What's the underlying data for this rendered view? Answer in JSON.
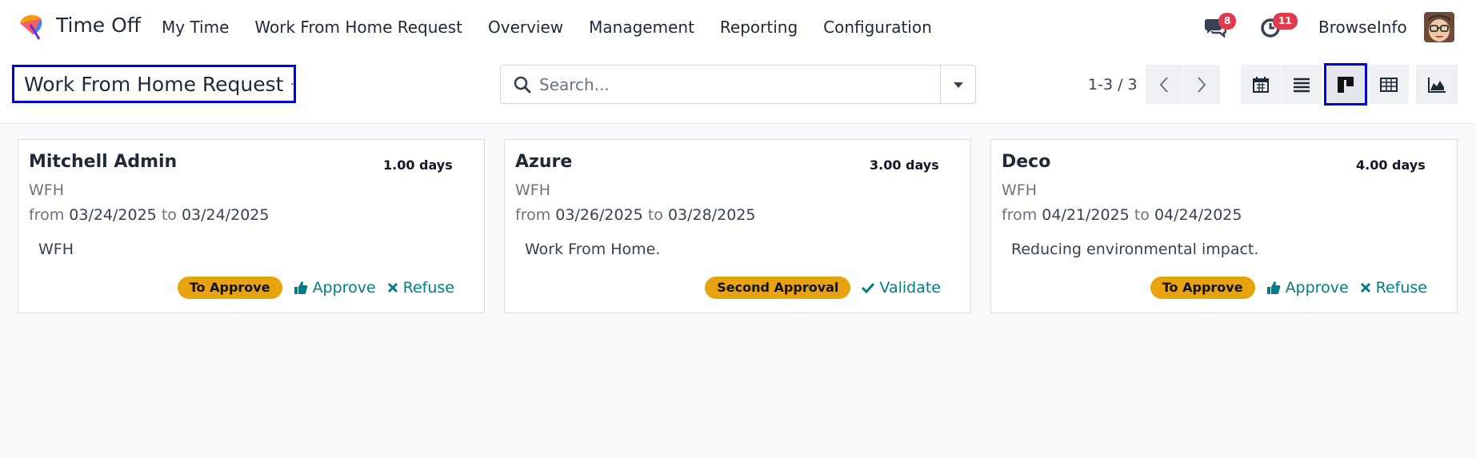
{
  "app": {
    "name": "Time Off"
  },
  "menu": [
    "My Time",
    "Work From Home Request",
    "Overview",
    "Management",
    "Reporting",
    "Configuration"
  ],
  "systray": {
    "messages_count": "8",
    "activities_count": "11",
    "company": "BrowseInfo"
  },
  "breadcrumb": {
    "title": "Work From Home Request"
  },
  "search": {
    "placeholder": "Search..."
  },
  "pager": {
    "value": "1-3 / 3"
  },
  "views": [
    "calendar-icon",
    "list-icon",
    "kanban-icon",
    "pivot-icon",
    "graph-icon"
  ],
  "cards": [
    {
      "name": "Mitchell Admin",
      "days": "1.00 days",
      "type": "WFH",
      "from_label": "from",
      "from": "03/24/2025",
      "to_label": "to",
      "to": "03/24/2025",
      "description": "WFH",
      "status": "To Approve",
      "actions": [
        "Approve",
        "Refuse"
      ]
    },
    {
      "name": "Azure",
      "days": "3.00 days",
      "type": "WFH",
      "from_label": "from",
      "from": "03/26/2025",
      "to_label": "to",
      "to": "03/28/2025",
      "description": "Work From Home.",
      "status": "Second Approval",
      "actions": [
        "Validate"
      ]
    },
    {
      "name": "Deco",
      "days": "4.00 days",
      "type": "WFH",
      "from_label": "from",
      "from": "04/21/2025",
      "to_label": "to",
      "to": "04/24/2025",
      "description": "Reducing environmental impact.",
      "status": "To Approve",
      "actions": [
        "Approve",
        "Refuse"
      ]
    }
  ],
  "colors": {
    "status_badge": "#e8a40e",
    "action": "#017e84",
    "highlight": "#0000d6",
    "notification": "#e03a4e"
  }
}
